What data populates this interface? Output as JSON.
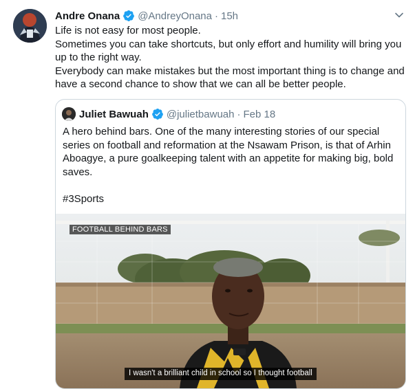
{
  "tweet": {
    "author_name": "Andre Onana",
    "handle": "@AndreyOnana",
    "separator": "·",
    "time": "15h",
    "lines": [
      "Life is not easy for most people.",
      "Sometimes you can take shortcuts, but only effort and humility will bring you up to the right way.",
      "Everybody can make mistakes but the most important thing is to change and have a second chance to show that we can all be better people."
    ]
  },
  "quote": {
    "author_name": "Juliet Bawuah",
    "handle": "@julietbawuah",
    "separator": "·",
    "time": "Feb 18",
    "text": "A hero behind bars. One of the many interesting stories of our special series on football and reformation at the Nsawam Prison, is that of Arhin Aboagye, a pure goalkeeping talent with an appetite for making big, bold saves.",
    "hashtag": "#3Sports",
    "video": {
      "overlay_label": "FOOTBALL BEHIND BARS",
      "subtitle": "I wasn't a brilliant child in school so I thought football"
    }
  },
  "colors": {
    "verified": "#1da1f2",
    "secondary_text": "#657786",
    "border": "#ccd6dd"
  },
  "icons": {
    "verified": "verified-badge-icon",
    "menu": "chevron-down-icon"
  }
}
